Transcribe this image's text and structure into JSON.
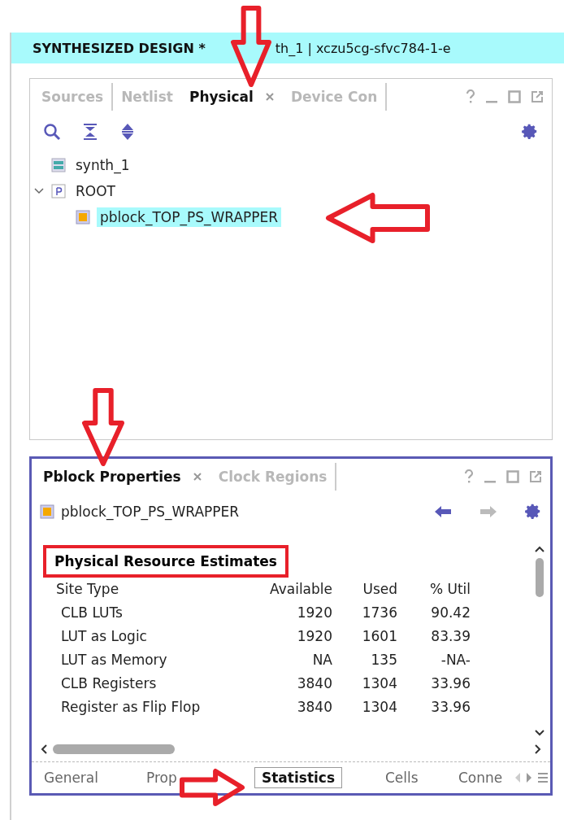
{
  "header": {
    "title": "SYNTHESIZED DESIGN *",
    "subtitle": "th_1 | xczu5cg-sfvc784-1-e"
  },
  "top_panel": {
    "tabs": [
      {
        "label": "Sources",
        "selected": false,
        "closable": false
      },
      {
        "label": "Netlist",
        "selected": false,
        "closable": false
      },
      {
        "label": "Physical",
        "selected": true,
        "closable": true
      },
      {
        "label": "Device Con",
        "selected": false,
        "closable": false
      }
    ],
    "tree": [
      {
        "label": "synth_1",
        "kind": "run",
        "selected": false
      },
      {
        "label": "ROOT",
        "kind": "root",
        "selected": false,
        "expanded": true,
        "children": [
          {
            "label": "pblock_TOP_PS_WRAPPER",
            "kind": "pblock",
            "selected": true
          }
        ]
      }
    ]
  },
  "bottom_panel": {
    "tabs": [
      {
        "label": "Pblock Properties",
        "selected": true,
        "closable": true
      },
      {
        "label": "Clock Regions",
        "selected": false,
        "closable": false
      }
    ],
    "object": "pblock_TOP_PS_WRAPPER",
    "section": {
      "title": "Physical Resource Estimates",
      "highlighted": true
    },
    "columns": [
      "Site Type",
      "Available",
      "Used",
      "% Util"
    ],
    "rows": [
      [
        "CLB LUTs",
        "1920",
        "1736",
        "90.42"
      ],
      [
        "LUT as Logic",
        "1920",
        "1601",
        "83.39"
      ],
      [
        "LUT as Memory",
        "NA",
        "135",
        "-NA-"
      ],
      [
        "CLB Registers",
        "3840",
        "1304",
        "33.96"
      ],
      [
        "Register as Flip Flop",
        "3840",
        "1304",
        "33.96"
      ]
    ],
    "subtabs": [
      {
        "label": "General",
        "selected": false
      },
      {
        "label": "Prop",
        "selected": false
      },
      {
        "label": "Statistics",
        "selected": true
      },
      {
        "label": "Cells",
        "selected": false
      },
      {
        "label": "Conne",
        "selected": false
      }
    ]
  },
  "annotations": [
    {
      "kind": "arrow-down"
    },
    {
      "kind": "arrow-left"
    },
    {
      "kind": "arrow-down"
    },
    {
      "kind": "arrow-right"
    }
  ]
}
